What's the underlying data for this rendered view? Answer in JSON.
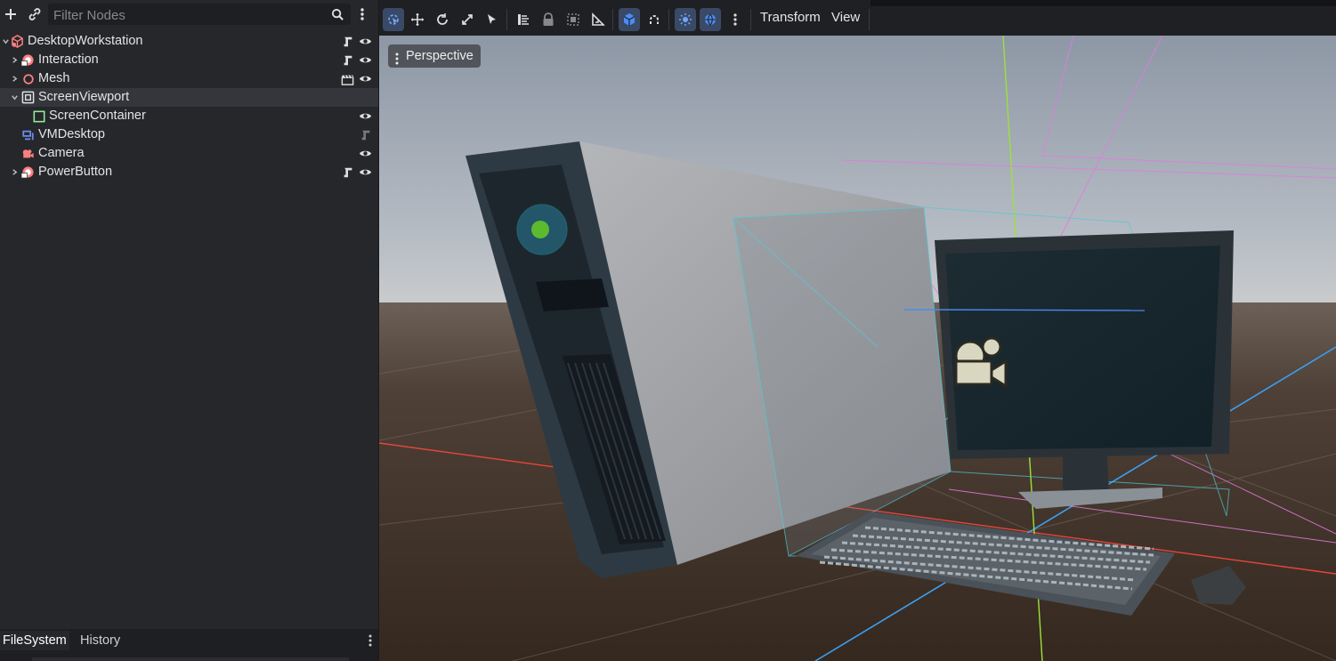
{
  "scene_panel": {
    "filter_placeholder": "Filter Nodes",
    "nodes": [
      {
        "label": "DesktopWorkstation",
        "icon": "node3d-root-icon"
      },
      {
        "label": "Interaction",
        "icon": "interaction-node-icon"
      },
      {
        "label": "Mesh",
        "icon": "mesh-node-icon"
      },
      {
        "label": "ScreenViewport",
        "icon": "subviewport-icon"
      },
      {
        "label": "ScreenContainer",
        "icon": "container-icon"
      },
      {
        "label": "VMDesktop",
        "icon": "vm-desktop-icon"
      },
      {
        "label": "Camera",
        "icon": "camera-node-icon"
      },
      {
        "label": "PowerButton",
        "icon": "interaction-node-icon"
      }
    ]
  },
  "bottom_tabs": {
    "filesystem": "FileSystem",
    "history": "History"
  },
  "viewport_toolbar": {
    "transform_menu": "Transform",
    "view_menu": "View"
  },
  "viewport": {
    "perspective_label": "Perspective"
  },
  "colors": {
    "accent": "#4b8cf5",
    "node_red": "#fc7f7f",
    "container_green": "#8eef97",
    "axis_x": "#e8453c",
    "axis_y": "#9be239",
    "axis_z": "#3aa0f5"
  }
}
